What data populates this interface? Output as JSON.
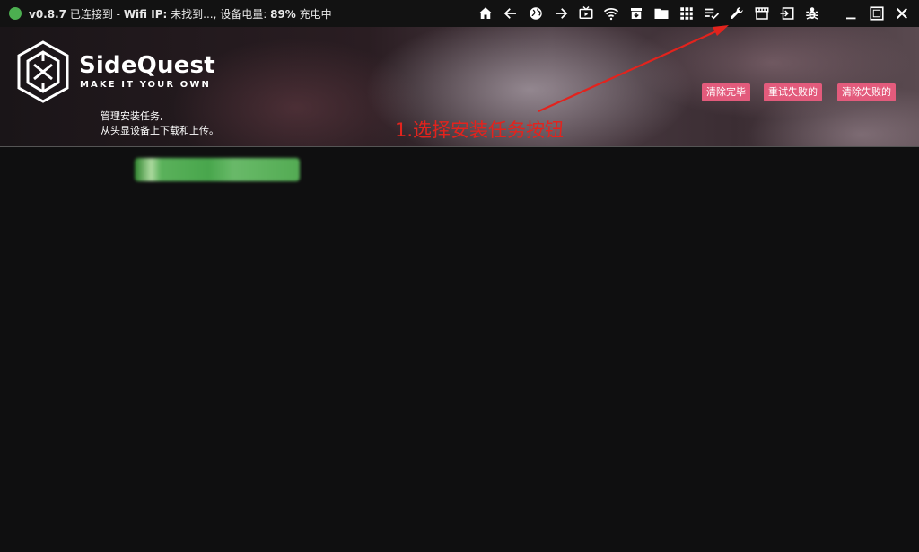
{
  "titlebar": {
    "status_color": "#4caf50",
    "version": "v0.8.7",
    "connection": "已连接到 -",
    "wifi_label": "Wifi IP:",
    "wifi_value": "未找到...,",
    "battery_label": "设备电量:",
    "battery_value": "89%",
    "charging": "充电中"
  },
  "toolbar_icons": [
    "home-icon",
    "back-icon",
    "globe-icon",
    "forward-icon",
    "tv-icon",
    "wifi-icon",
    "archive-icon",
    "folder-icon",
    "apps-grid-icon",
    "task-list-icon",
    "wrench-icon",
    "store-icon",
    "import-icon",
    "bug-icon",
    "minimize-icon",
    "maximize-icon",
    "close-icon"
  ],
  "banner": {
    "brand": "SideQuest",
    "tagline": "MAKE IT YOUR OWN",
    "desc_line1": "管理安装任务,",
    "desc_line2": "从头显设备上下载和上传。",
    "buttons": {
      "clear_done": "清除完毕",
      "retry_failed": "重试失败的",
      "clear_failed": "清除失败的"
    },
    "accent": "#e35b7c"
  },
  "annotation": {
    "text": "1.选择安装任务按钮",
    "color": "#e3231d"
  }
}
